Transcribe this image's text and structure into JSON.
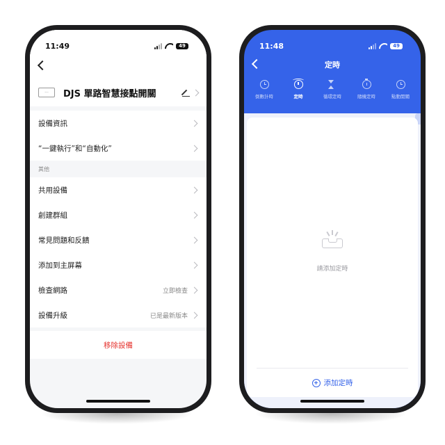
{
  "phone1": {
    "status": {
      "time": "11:49",
      "battery": "49"
    },
    "device_thumb": "···",
    "device_name": "DJS 單路智慧接點開關",
    "rows_top": [
      {
        "label": "設備資訊"
      },
      {
        "label": "“一鍵執行”和“自動化”"
      }
    ],
    "section_header": "其他",
    "rows_other": [
      {
        "label": "共用設備",
        "value": ""
      },
      {
        "label": "創建群組",
        "value": ""
      },
      {
        "label": "常見問題和反饋",
        "value": ""
      },
      {
        "label": "添加到主屏幕",
        "value": ""
      },
      {
        "label": "檢查網路",
        "value": "立即檢查"
      },
      {
        "label": "設備升級",
        "value": "已是最新版本"
      }
    ],
    "remove_label": "移除設備"
  },
  "phone2": {
    "status": {
      "time": "11:48",
      "battery": "49"
    },
    "title": "定時",
    "tabs": [
      {
        "label": "倒數計時",
        "icon": "clock-icon"
      },
      {
        "label": "定時",
        "icon": "alarm-clock-icon"
      },
      {
        "label": "循環定時",
        "icon": "hourglass-icon"
      },
      {
        "label": "隨機定時",
        "icon": "stopwatch-icon"
      },
      {
        "label": "點動開關",
        "icon": "clock-icon"
      }
    ],
    "active_tab": 1,
    "empty_text": "請添加定時",
    "add_label": "添加定時"
  },
  "colors": {
    "accent": "#3563e9",
    "danger": "#e5322d",
    "background": "#f5f6f8"
  }
}
